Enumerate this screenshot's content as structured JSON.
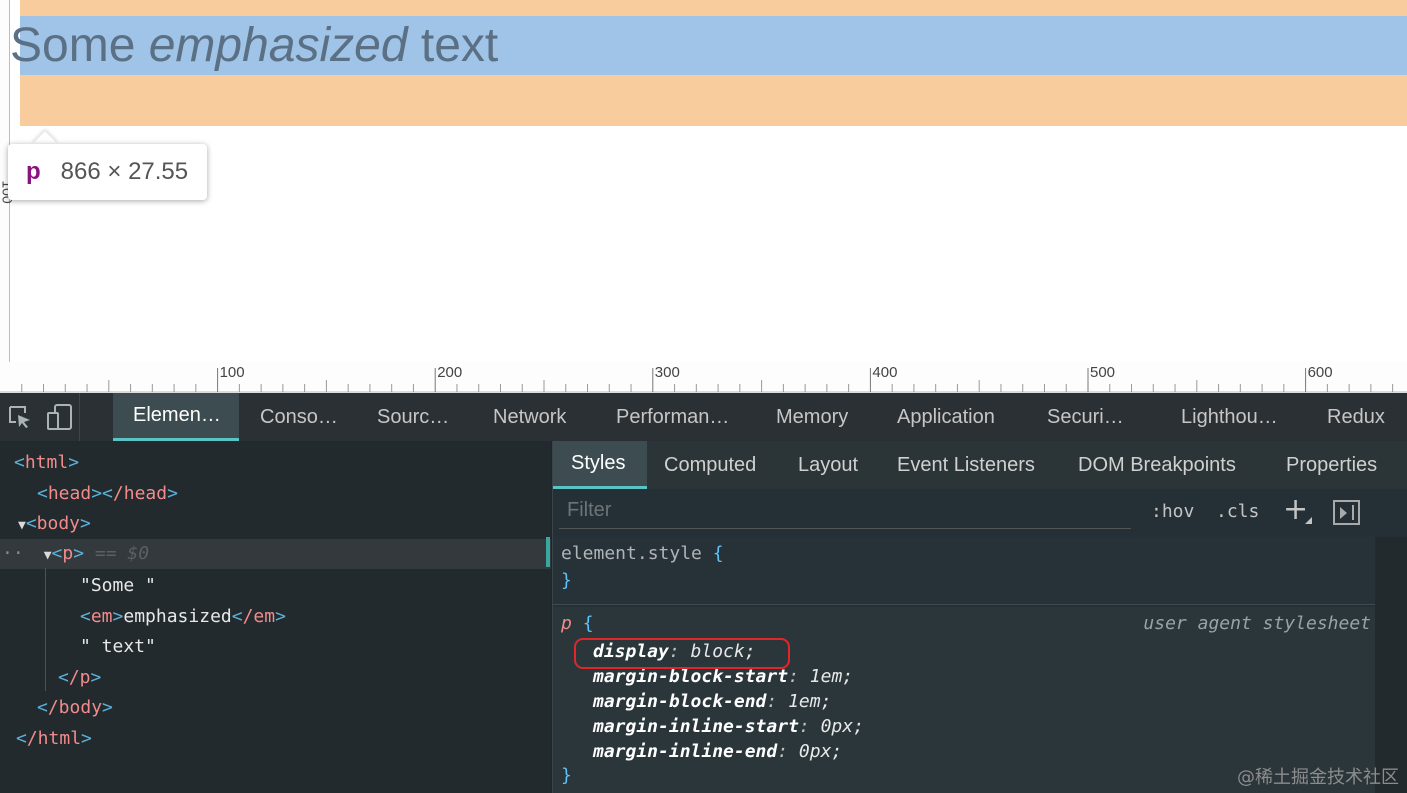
{
  "page": {
    "text_before": "Some ",
    "text_emphasized": "emphasized",
    "text_after": " text",
    "left_ruler_label": "100",
    "ruler_labels": [
      "100",
      "200",
      "300",
      "400",
      "500",
      "600"
    ]
  },
  "tooltip": {
    "tag": "p",
    "size": "866 × 27.55"
  },
  "devtools": {
    "tabs": [
      {
        "label": "Elemen…",
        "active": true
      },
      {
        "label": "Conso…",
        "active": false
      },
      {
        "label": "Sourc…",
        "active": false
      },
      {
        "label": "Network",
        "active": false
      },
      {
        "label": "Performan…",
        "active": false
      },
      {
        "label": "Memory",
        "active": false
      },
      {
        "label": "Application",
        "active": false
      },
      {
        "label": "Securi…",
        "active": false
      },
      {
        "label": "Lighthou…",
        "active": false
      },
      {
        "label": "Redux",
        "active": false
      }
    ],
    "dom_tree": {
      "html_open": "html",
      "head_open": "head",
      "head_close": "/head",
      "body_open": "body",
      "p_open": "p",
      "selected_marker": "== $0",
      "text_some": "\"Some \"",
      "em_open": "em",
      "em_text": "emphasized",
      "em_close": "/em",
      "text_text": "\" text\"",
      "p_close": "/p",
      "body_close": "/body",
      "html_close": "/html"
    },
    "styles": {
      "subtabs": [
        {
          "label": "Styles",
          "active": true
        },
        {
          "label": "Computed",
          "active": false
        },
        {
          "label": "Layout",
          "active": false
        },
        {
          "label": "Event Listeners",
          "active": false
        },
        {
          "label": "DOM Breakpoints",
          "active": false
        },
        {
          "label": "Properties",
          "active": false
        }
      ],
      "filter_placeholder": "Filter",
      "hov": ":hov",
      "cls": ".cls",
      "plus": "+",
      "element_style_selector": "element.style",
      "open_brace": "{",
      "close_brace": "}",
      "p_selector": "p",
      "user_agent_label": "user agent stylesheet",
      "declarations": [
        {
          "prop": "display",
          "value": "block;"
        },
        {
          "prop": "margin-block-start",
          "value": "1em;"
        },
        {
          "prop": "margin-block-end",
          "value": "1em;"
        },
        {
          "prop": "margin-inline-start",
          "value": "0px;"
        },
        {
          "prop": "margin-inline-end",
          "value": "0px;"
        }
      ]
    }
  },
  "watermark": "@稀土掘金技术社区",
  "colors": {
    "margin_highlight": "#f9cc9d",
    "content_highlight": "#9fc4e7",
    "accent": "#5ac3c3",
    "annotation_red": "#e0262a"
  }
}
